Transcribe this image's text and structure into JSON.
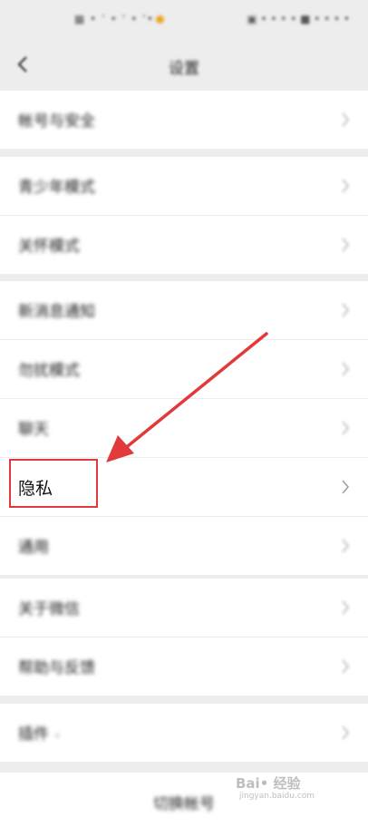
{
  "status_bar": {
    "left": "▦ • ’ • ‘ • ‘•",
    "right": "▣ • • • • ■ • • • •"
  },
  "nav": {
    "back_icon": "chevron-left",
    "title": "设置"
  },
  "groups": [
    {
      "items": [
        {
          "label": "帐号与安全"
        }
      ]
    },
    {
      "items": [
        {
          "label": "青少年模式"
        },
        {
          "label": "关怀模式"
        }
      ]
    },
    {
      "items": [
        {
          "label": "新消息通知"
        },
        {
          "label": "勿扰模式"
        },
        {
          "label": "聊天"
        },
        {
          "label": "隐私"
        },
        {
          "label": "通用"
        }
      ]
    },
    {
      "items": [
        {
          "label": "关于微信"
        },
        {
          "label": "帮助与反馈"
        }
      ]
    },
    {
      "items": [
        {
          "label": "插件",
          "badge": "•"
        }
      ]
    }
  ],
  "bottom": {
    "label": "切换帐号"
  },
  "watermark": {
    "text": "Bai• 经验",
    "sub": "jingyan.baidu.com"
  },
  "colors": {
    "background": "#ededed",
    "row": "#ffffff",
    "highlight": "#e23a3a"
  }
}
